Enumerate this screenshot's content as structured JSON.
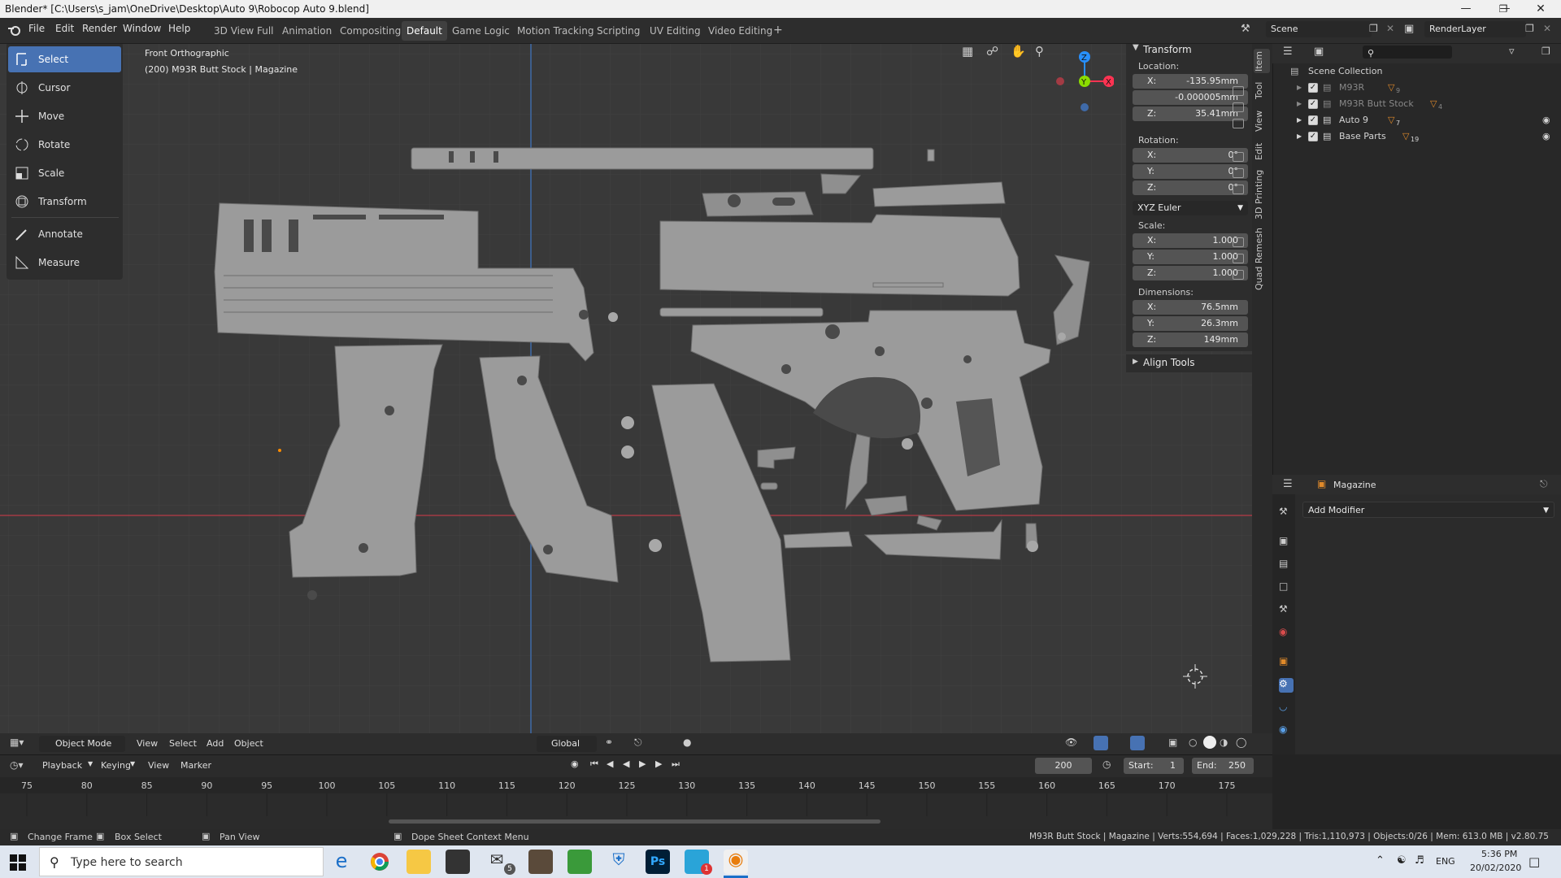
{
  "window": {
    "title": "Blender* [C:\\Users\\s_jam\\OneDrive\\Desktop\\Auto 9\\Robocop Auto 9.blend]"
  },
  "menus": [
    "File",
    "Edit",
    "Render",
    "Window",
    "Help"
  ],
  "workspaces": [
    "3D View Full",
    "Animation",
    "Compositing",
    "Default",
    "Game Logic",
    "Motion Tracking",
    "Scripting",
    "UV Editing",
    "Video Editing"
  ],
  "active_workspace": "Default",
  "scene": {
    "name": "Scene",
    "render_layer": "RenderLayer"
  },
  "viewport": {
    "view_name": "Front Orthographic",
    "context": "(200) M93R Butt Stock | Magazine",
    "mode": "Object Mode",
    "header_menus": [
      "View",
      "Select",
      "Add",
      "Object"
    ],
    "transform_orientation": "Global"
  },
  "tools": [
    "Select",
    "Cursor",
    "Move",
    "Rotate",
    "Scale",
    "Transform",
    "Annotate",
    "Measure"
  ],
  "active_tool": "Select",
  "npanel": {
    "tabs": [
      "Item",
      "Tool",
      "View",
      "Edit",
      "3D Printing",
      "Quad Remesh"
    ],
    "transform_header": "Transform",
    "location_label": "Location:",
    "location": {
      "x": "-135.95mm",
      "y": "-0.000005mm",
      "z": "35.41mm"
    },
    "rotation_label": "Rotation:",
    "rotation": {
      "x": "0°",
      "y": "0°",
      "z": "0°"
    },
    "rotation_mode": "XYZ Euler",
    "scale_label": "Scale:",
    "scale": {
      "x": "1.000",
      "y": "1.000",
      "z": "1.000"
    },
    "dimensions_label": "Dimensions:",
    "dimensions": {
      "x": "76.5mm",
      "y": "26.3mm",
      "z": "149mm"
    },
    "align_tools": "Align Tools",
    "axis_labels": {
      "x": "X:",
      "y": "Y:",
      "z": "Z:"
    }
  },
  "outliner": {
    "root": "Scene Collection",
    "items": [
      {
        "name": "M93R",
        "count": "9"
      },
      {
        "name": "M93R Butt Stock",
        "count": "4"
      },
      {
        "name": "Auto 9",
        "count": "7"
      },
      {
        "name": "Base Parts",
        "count": "19"
      }
    ]
  },
  "properties": {
    "object": "Magazine",
    "add_modifier": "Add Modifier"
  },
  "timeline": {
    "menus": [
      "Playback",
      "Keying",
      "View",
      "Marker"
    ],
    "current_frame": "200",
    "start_label": "Start:",
    "start": "1",
    "end_label": "End:",
    "end": "250",
    "ticks": [
      "75",
      "80",
      "85",
      "90",
      "95",
      "100",
      "105",
      "110",
      "115",
      "120",
      "125",
      "130",
      "135",
      "140",
      "145",
      "150",
      "155",
      "160",
      "165",
      "170",
      "175"
    ]
  },
  "statusbar": {
    "hints": [
      "Change Frame",
      "Box Select",
      "Pan View",
      "Dope Sheet Context Menu"
    ],
    "info": "M93R Butt Stock | Magazine | Verts:554,694 | Faces:1,029,228 | Tris:1,110,973 | Objects:0/26 | Mem: 613.0 MB | v2.80.75"
  },
  "taskbar": {
    "search_placeholder": "Type here to search",
    "lang": "ENG",
    "time": "5:36 PM",
    "date": "20/02/2020",
    "mail_badge": "5",
    "app_badge": "1"
  },
  "colors": {
    "accent": "#4772b3",
    "x_axis": "#ff3352",
    "y_axis": "#8bdc00",
    "z_axis": "#2890ff"
  }
}
